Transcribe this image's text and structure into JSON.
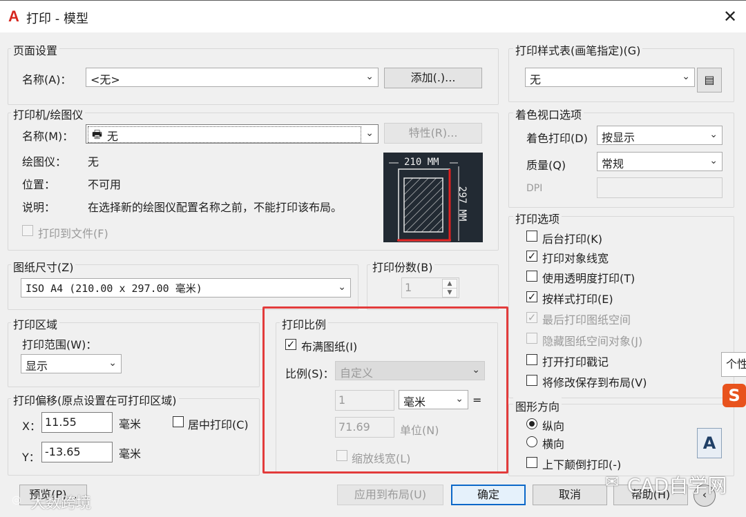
{
  "window": {
    "title": "打印 - 模型"
  },
  "page_setup": {
    "title": "页面设置",
    "name_label": "名称(A)：",
    "name_value": "<无>",
    "add_button": "添加(.)..."
  },
  "printer": {
    "title": "打印机/绘图仪",
    "name_label": "名称(M)：",
    "name_value": "无",
    "properties_button": "特性(R)...",
    "plotter_label": "绘图仪：",
    "plotter_value": "无",
    "location_label": "位置：",
    "location_value": "不可用",
    "desc_label": "说明：",
    "desc_value": "在选择新的绘图仪配置名称之前，不能打印该布局。",
    "print_to_file": "打印到文件(F)",
    "preview_width": "210 MM",
    "preview_height": "297 MM"
  },
  "paper": {
    "title": "图纸尺寸(Z)",
    "value": "ISO A4 (210.00 x 297.00 毫米)"
  },
  "copies": {
    "title": "打印份数(B)",
    "value": "1"
  },
  "area": {
    "title": "打印区域",
    "range_label": "打印范围(W)：",
    "range_value": "显示"
  },
  "offset": {
    "title": "打印偏移(原点设置在可打印区域)",
    "x_label": "X：",
    "x_value": "11.55",
    "x_unit": "毫米",
    "center": "居中打印(C)",
    "y_label": "Y：",
    "y_value": "-13.65",
    "y_unit": "毫米"
  },
  "scale": {
    "title": "打印比例",
    "fit": "布满图纸(I)",
    "scale_label": "比例(S)：",
    "scale_value": "自定义",
    "value1": "1",
    "unit": "毫米",
    "equals": "=",
    "value2": "71.69",
    "unit2": "单位(N)",
    "lineweights": "缩放线宽(L)"
  },
  "style_table": {
    "title": "打印样式表(画笔指定)(G)",
    "value": "无"
  },
  "shaded": {
    "title": "着色视口选项",
    "shade_label": "着色打印(D)",
    "shade_value": "按显示",
    "quality_label": "质量(Q)",
    "quality_value": "常规",
    "dpi_label": "DPI"
  },
  "options": {
    "title": "打印选项",
    "items": [
      "后台打印(K)",
      "打印对象线宽",
      "使用透明度打印(T)",
      "按样式打印(E)",
      "最后打印图纸空间",
      "隐藏图纸空间对象(J)",
      "打开打印戳记",
      "将修改保存到布局(V)"
    ]
  },
  "orientation": {
    "title": "图形方向",
    "portrait": "纵向",
    "landscape": "横向",
    "upside_down": "上下颠倒打印(-)",
    "icon_letter": "A"
  },
  "buttons": {
    "preview": "预览(P)...",
    "apply": "应用到布局(U)",
    "ok": "确定",
    "cancel": "取消",
    "help": "帮助(H)"
  },
  "overlays": {
    "side_tip": "个性",
    "watermark_left": "大数跨境",
    "watermark_right": "CAD自学网"
  }
}
